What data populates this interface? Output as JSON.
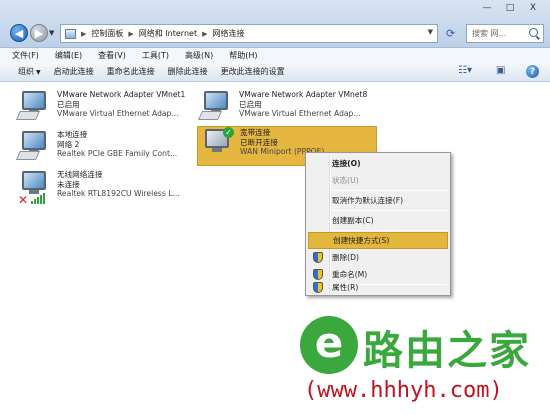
{
  "window": {
    "minimize_label": "—",
    "maximize_label": "□",
    "close_label": "X"
  },
  "address": {
    "segments": [
      "控制面板",
      "网络和 Internet",
      "网络连接"
    ],
    "separator": "▶"
  },
  "search": {
    "placeholder": "搜索 网..."
  },
  "menu": {
    "items": [
      "文件(F)",
      "编辑(E)",
      "查看(V)",
      "工具(T)",
      "高级(N)",
      "帮助(H)"
    ]
  },
  "commands": {
    "items": [
      "组织",
      "启动此连接",
      "重命名此连接",
      "删除此连接",
      "更改此连接的设置"
    ]
  },
  "adapters": [
    {
      "name": "VMware Network Adapter VMnet1",
      "status": "已启用",
      "device": "VMware Virtual Ethernet Adap..."
    },
    {
      "name": "VMware Network Adapter VMnet8",
      "status": "已启用",
      "device": "VMware Virtual Ethernet Adap..."
    },
    {
      "name": "本地连接",
      "status": "网络  2",
      "device": "Realtek PCIe GBE Family Cont..."
    },
    {
      "name": "宽带连接",
      "status": "已断开连接",
      "device": "WAN Miniport (PPPOE)"
    },
    {
      "name": "无线网络连接",
      "status": "未连接",
      "device": "Realtek RTL8192CU Wireless L..."
    }
  ],
  "context_menu": {
    "items": [
      "连接(O)",
      "状态(U)",
      "取消作为默认连接(F)",
      "创建副本(C)",
      "创建快捷方式(S)",
      "删除(D)",
      "重命名(M)",
      "属性(R)"
    ]
  },
  "watermark": {
    "logo_letter": "e",
    "brand": "路由之家",
    "url": "www.hhhyh.com"
  },
  "colors": {
    "selection": "#e5b640",
    "watermark_green": "#3aa83c",
    "watermark_red": "#c1121f"
  }
}
